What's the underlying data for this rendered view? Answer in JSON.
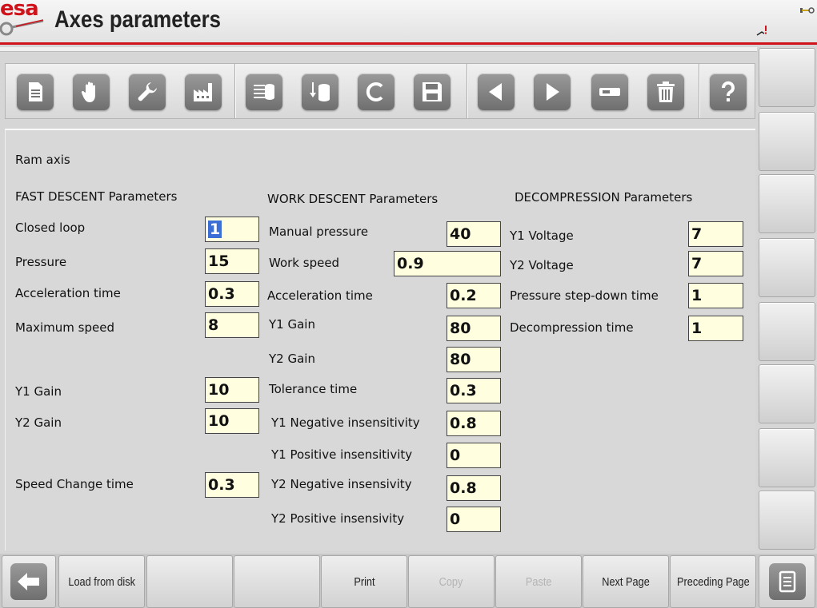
{
  "header": {
    "logo_text": "esa",
    "title": "Axes parameters"
  },
  "toolbar": {
    "buttons": [
      {
        "name": "document-icon"
      },
      {
        "name": "hand-icon"
      },
      {
        "name": "wrench-icon"
      },
      {
        "name": "factory-icon"
      },
      {
        "name": "database-list-icon"
      },
      {
        "name": "database-transfer-icon"
      },
      {
        "name": "letter-c-icon"
      },
      {
        "name": "save-icon"
      },
      {
        "name": "arrow-left-icon"
      },
      {
        "name": "arrow-right-icon"
      },
      {
        "name": "minus-field-icon"
      },
      {
        "name": "trash-icon"
      },
      {
        "name": "help-icon"
      }
    ]
  },
  "panel": {
    "axis_label": "Ram axis",
    "fast": {
      "title": "FAST DESCENT Parameters",
      "closed_loop_label": "Closed loop",
      "closed_loop": "1",
      "pressure_label": "Pressure",
      "pressure": "15",
      "accel_label": "Acceleration time",
      "accel": "0.3",
      "max_speed_label": "Maximum speed",
      "max_speed": "8",
      "y1_gain_label": "Y1 Gain",
      "y1_gain": "10",
      "y2_gain_label": "Y2 Gain",
      "y2_gain": "10",
      "speed_change_label": "Speed Change time",
      "speed_change": "0.3"
    },
    "work": {
      "title": "WORK DESCENT Parameters",
      "manual_pressure_label": "Manual pressure",
      "manual_pressure": "40",
      "work_speed_label": "Work speed",
      "work_speed": "0.9",
      "accel_label": "Acceleration time",
      "accel": "0.2",
      "y1_gain_label": "Y1 Gain",
      "y1_gain": "80",
      "y2_gain_label": "Y2 Gain",
      "y2_gain": "80",
      "tolerance_label": "Tolerance time",
      "tolerance": "0.3",
      "y1_neg_label": "Y1 Negative insensitivity",
      "y1_neg": "0.8",
      "y1_pos_label": "Y1 Positive insensitivity",
      "y1_pos": "0",
      "y2_neg_label": "Y2 Negative insensivity",
      "y2_neg": "0.8",
      "y2_pos_label": "Y2 Positive insensivity",
      "y2_pos": "0"
    },
    "decomp": {
      "title": "DECOMPRESSION Parameters",
      "y1_voltage_label": "Y1 Voltage",
      "y1_voltage": "7",
      "y2_voltage_label": "Y2 Voltage",
      "y2_voltage": "7",
      "step_down_label": "Pressure step-down time",
      "step_down": "1",
      "decomp_time_label": "Decompression time",
      "decomp_time": "1"
    }
  },
  "bottom": {
    "load": "Load from disk",
    "print": "Print",
    "copy": "Copy",
    "paste": "Paste",
    "next": "Next Page",
    "prev": "Preceding Page"
  },
  "colors": {
    "accent_red": "#d0121b",
    "field_bg": "#ffffe0",
    "selection": "#3b6fd6"
  }
}
